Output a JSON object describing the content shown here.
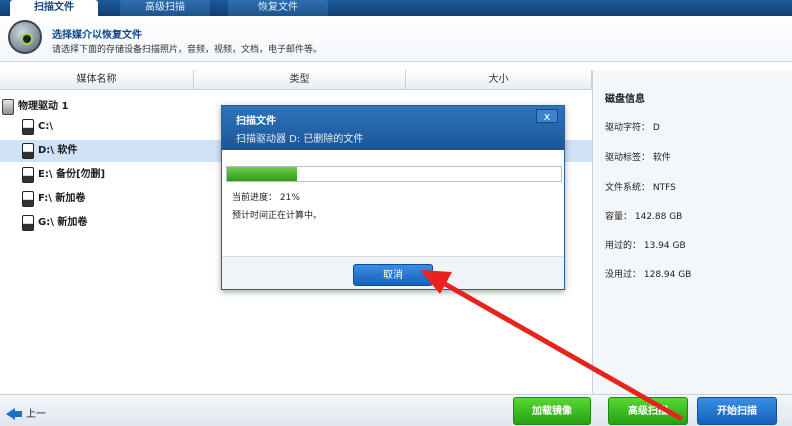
{
  "tabs": [
    {
      "label": "扫描文件",
      "active": true
    },
    {
      "label": "高级扫描",
      "active": false
    },
    {
      "label": "恢复文件",
      "active": false
    }
  ],
  "header": {
    "title": "选择媒介以恢复文件",
    "subtitle": "请选择下面的存储设备扫描照片，音频，视频，文档，电子邮件等。"
  },
  "table": {
    "columns": [
      "媒体名称",
      "类型",
      "大小"
    ],
    "root": "物理驱动 1",
    "drives": [
      {
        "label": "C:\\",
        "selected": false
      },
      {
        "label": "D:\\ 软件",
        "selected": true
      },
      {
        "label": "E:\\ 备份[勿删]",
        "selected": false
      },
      {
        "label": "F:\\ 新加卷",
        "selected": false
      },
      {
        "label": "G:\\ 新加卷",
        "selected": false
      }
    ]
  },
  "info": {
    "title": "磁盘信息",
    "rows": [
      "驱动字符： D",
      "驱动标签： 软件",
      "文件系统： NTFS",
      "容量： 142.88 GB",
      "用过的： 13.94 GB",
      "没用过： 128.94 GB"
    ]
  },
  "modal": {
    "title": "扫描文件",
    "subtitle": "扫描驱动器 D: 已删除的文件",
    "close_label": "x",
    "progress_percent": 21,
    "progress_text": "当前进度： 21%",
    "eta_text": "预计时间正在计算中。",
    "cancel_label": "取消"
  },
  "footer": {
    "back_label": "上一",
    "load_image_label": "加载镜像",
    "advanced_scan_label": "高级扫描",
    "start_scan_label": "开始扫描"
  },
  "colors": {
    "accent_blue": "#1b5596",
    "green_button": "#25a014",
    "annotation_red": "#e8231d"
  }
}
